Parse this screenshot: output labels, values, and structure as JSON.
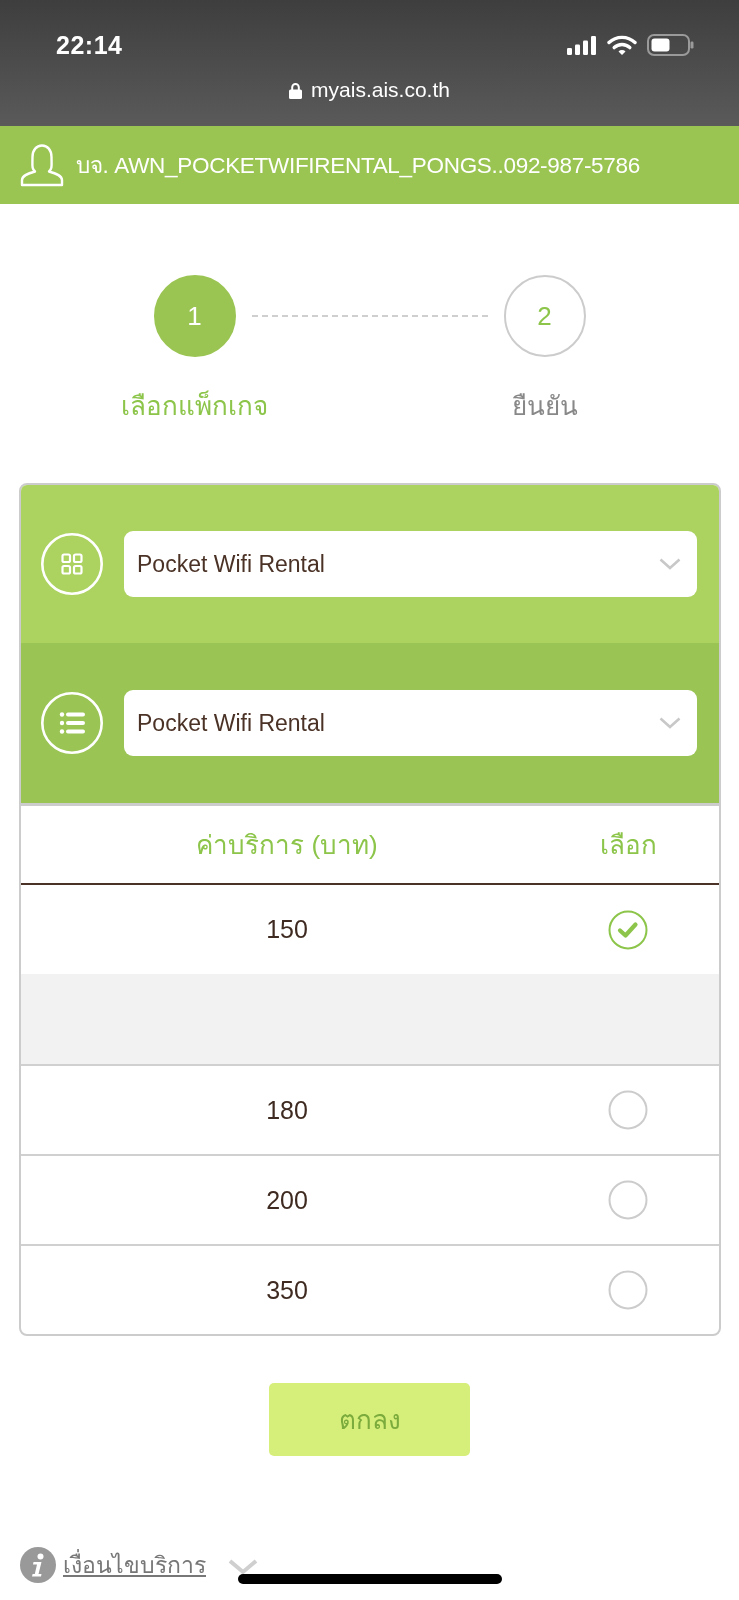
{
  "status_bar": {
    "time": "22:14",
    "url": "myais.ais.co.th"
  },
  "account_bar": {
    "account": "บจ. AWN_POCKETWIFIRENTAL_PONGS..092-987-5786"
  },
  "steps": [
    {
      "number": "1",
      "label": "เลือกแพ็กเกจ",
      "selected": true
    },
    {
      "number": "2",
      "label": "ยืนยัน",
      "selected": false
    }
  ],
  "selectors": [
    {
      "kind": "category",
      "value": "Pocket Wifi Rental"
    },
    {
      "kind": "package",
      "value": "Pocket Wifi Rental"
    }
  ],
  "table": {
    "columns": [
      "ค่าบริการ (บาท)",
      "เลือก"
    ],
    "rows": [
      {
        "price": "150",
        "selected": true,
        "expanded": true
      },
      {
        "price": "180",
        "selected": false,
        "expanded": false
      },
      {
        "price": "200",
        "selected": false,
        "expanded": false
      },
      {
        "price": "350",
        "selected": false,
        "expanded": false
      }
    ]
  },
  "confirm_button": "ตกลง",
  "footer": {
    "terms_link": "เงื่อนไขบริการ",
    "expanded": false
  }
}
